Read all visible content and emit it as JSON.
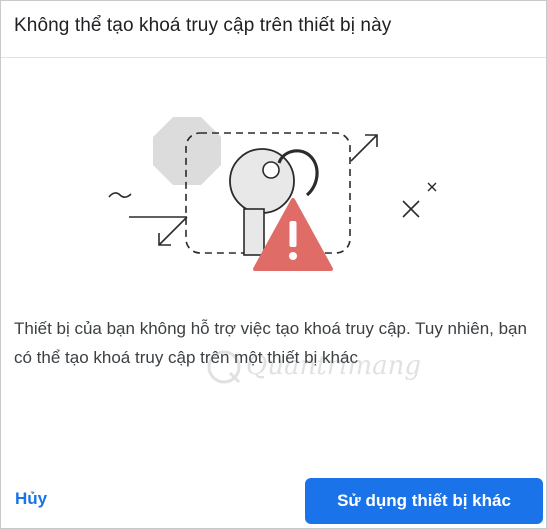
{
  "dialog": {
    "title": "Không thể tạo khoá truy cập trên thiết bị này",
    "message": "Thiết bị của bạn không hỗ trợ việc tạo khoá truy cập. Tuy nhiên, bạn có thể tạo khoá truy cập trên một thiết bị khác",
    "cancel_label": "Hủy",
    "primary_label": "Sử dụng thiết bị khác"
  },
  "watermark": {
    "text": "Quantrimang"
  },
  "colors": {
    "primary": "#1a73e8",
    "warning": "#e06c68",
    "octagon": "#dcdcdc",
    "key": "#e8e8e8"
  },
  "icons": {
    "illustration": "passkey-error-illustration",
    "warning": "warning-triangle-icon"
  }
}
